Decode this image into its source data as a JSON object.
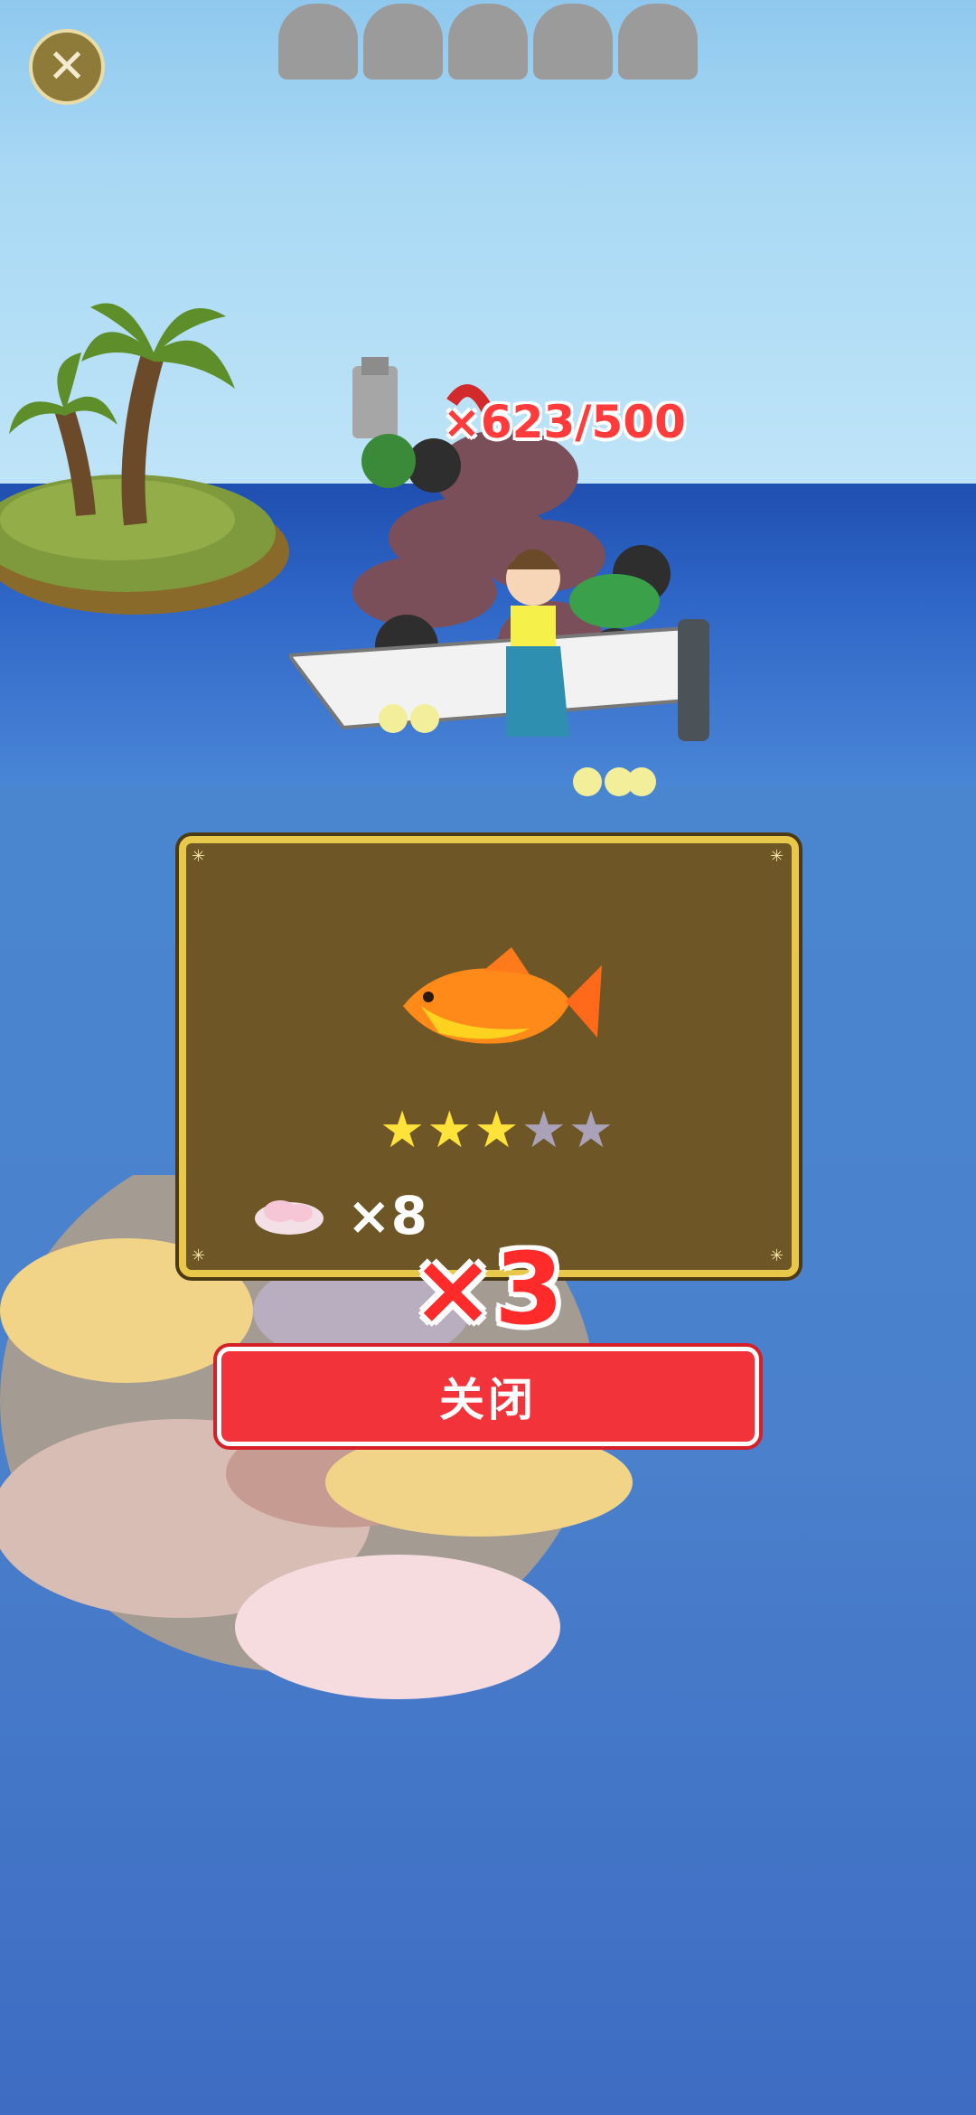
{
  "hud": {
    "close_icon": "close-icon",
    "slot_count": 5
  },
  "catch": {
    "count_text": "×623/500"
  },
  "result_panel": {
    "fish_icon": "goldfish-icon",
    "rating": 3,
    "max_rating": 5,
    "bait_icon": "bait-icon",
    "bait_count": "×8",
    "multiplier": "×3"
  },
  "actions": {
    "close_label": "关闭"
  },
  "colors": {
    "star_filled": "#ffe23a",
    "star_empty": "#a9a2b8",
    "button": "#f2333a",
    "panel": "#6e5626",
    "panel_border": "#e8c84b"
  }
}
